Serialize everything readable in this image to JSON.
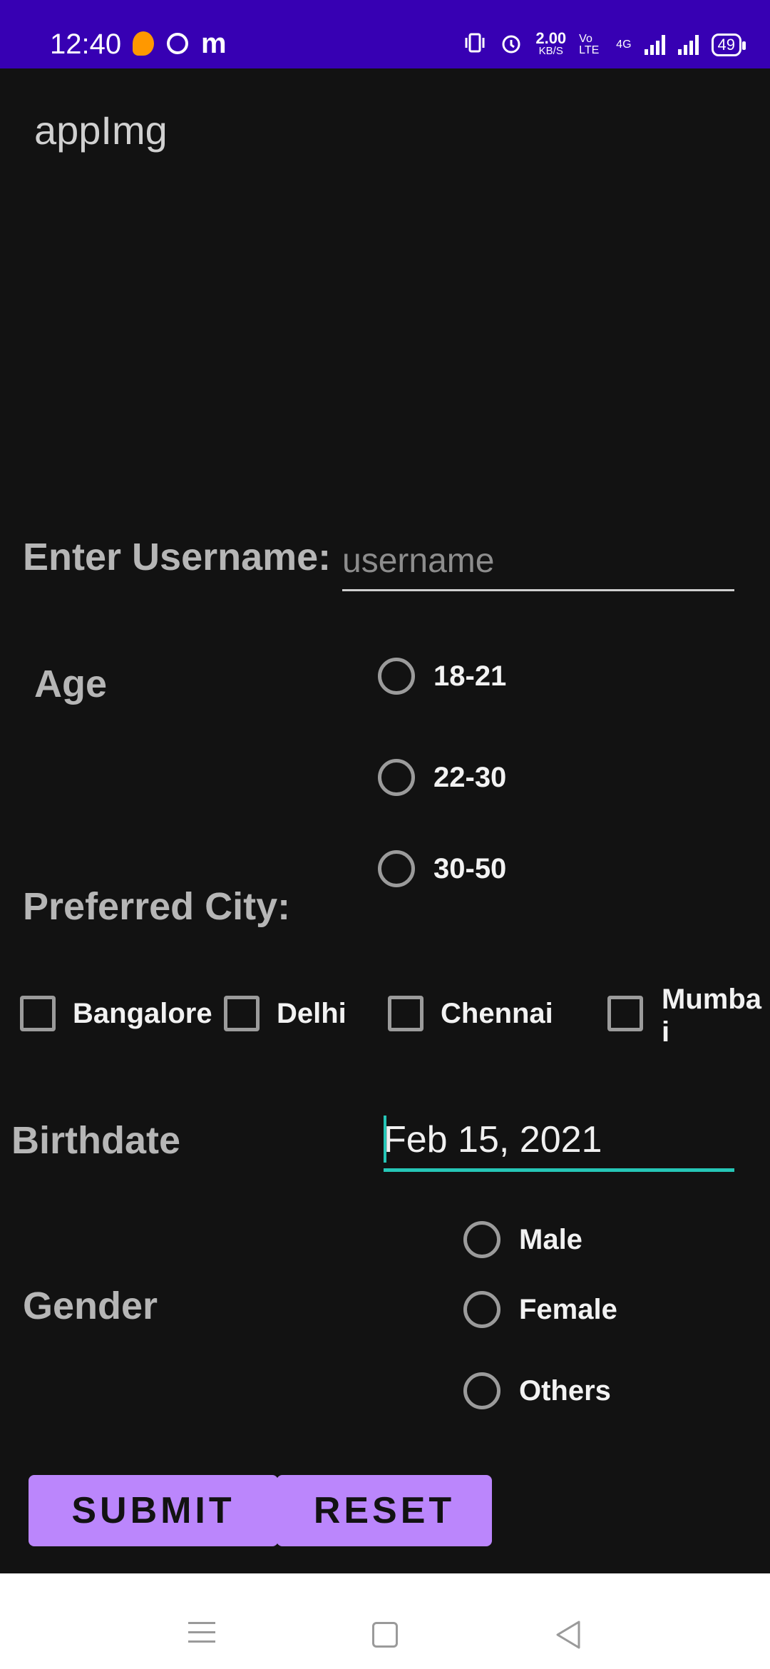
{
  "status_bar": {
    "time": "12:40",
    "speed": "2.00",
    "speed_unit": "KB/S",
    "volte": "Vo LTE",
    "network": "4G",
    "battery": "49",
    "icons": [
      "orange-bubble-icon",
      "chrome-icon",
      "m-icon",
      "vibrate-icon",
      "alarm-icon",
      "signal-icon"
    ]
  },
  "app": {
    "title": "appImg"
  },
  "form": {
    "username_label": "Enter Username:",
    "username_placeholder": "username",
    "username_value": "",
    "age_label": "Age",
    "age_options": [
      "18-21",
      "22-30",
      "30-50"
    ],
    "city_label": "Preferred City:",
    "city_options": [
      "Bangalore",
      "Delhi",
      "Chennai",
      "Mumbai"
    ],
    "birthdate_label": "Birthdate",
    "birthdate_value": "Feb 15, 2021",
    "gender_label": "Gender",
    "gender_options": [
      "Male",
      "Female",
      "Others"
    ],
    "submit_label": "SUBMIT",
    "reset_label": "RESET"
  },
  "colors": {
    "status_bar": "#3700b3",
    "background": "#121212",
    "button": "#bb86fc",
    "accent": "#26c6b7"
  },
  "nav_bar": {
    "icons": [
      "menu-icon",
      "home-icon",
      "back-icon"
    ]
  }
}
